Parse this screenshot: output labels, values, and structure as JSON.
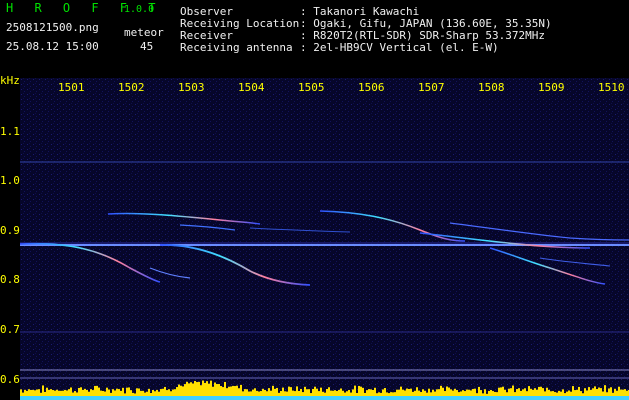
{
  "app": {
    "name": "H R O F F T",
    "version": "1.0.0"
  },
  "file": {
    "name": "2508121500.png",
    "datetime": "25.08.12 15:00"
  },
  "detection": {
    "label": "meteor",
    "count": "45"
  },
  "info": [
    {
      "key": "Observer",
      "value": ": Takanori Kawachi"
    },
    {
      "key": "Receiving Location",
      "value": ": Ogaki, Gifu, JAPAN (136.60E, 35.35N)"
    },
    {
      "key": "Receiver",
      "value": ": R820T2(RTL-SDR) SDR-Sharp 53.372MHz"
    },
    {
      "key": "Receiving antenna",
      "value": ": 2el-HB9CV Vertical (el. E-W)"
    }
  ],
  "spectrogram": {
    "y_unit": "kHz",
    "y_ticks": [
      "1.1",
      "1.0",
      "0.9",
      "0.8",
      "0.7",
      "0.6"
    ],
    "x_ticks": [
      "1501",
      "1502",
      "1503",
      "1504",
      "1505",
      "1506",
      "1507",
      "1508",
      "1509",
      "1510"
    ],
    "colors": {
      "background": "#06062a",
      "label": "#ffff00",
      "header_green": "#00e000",
      "header_white": "#f0f0f0"
    }
  }
}
